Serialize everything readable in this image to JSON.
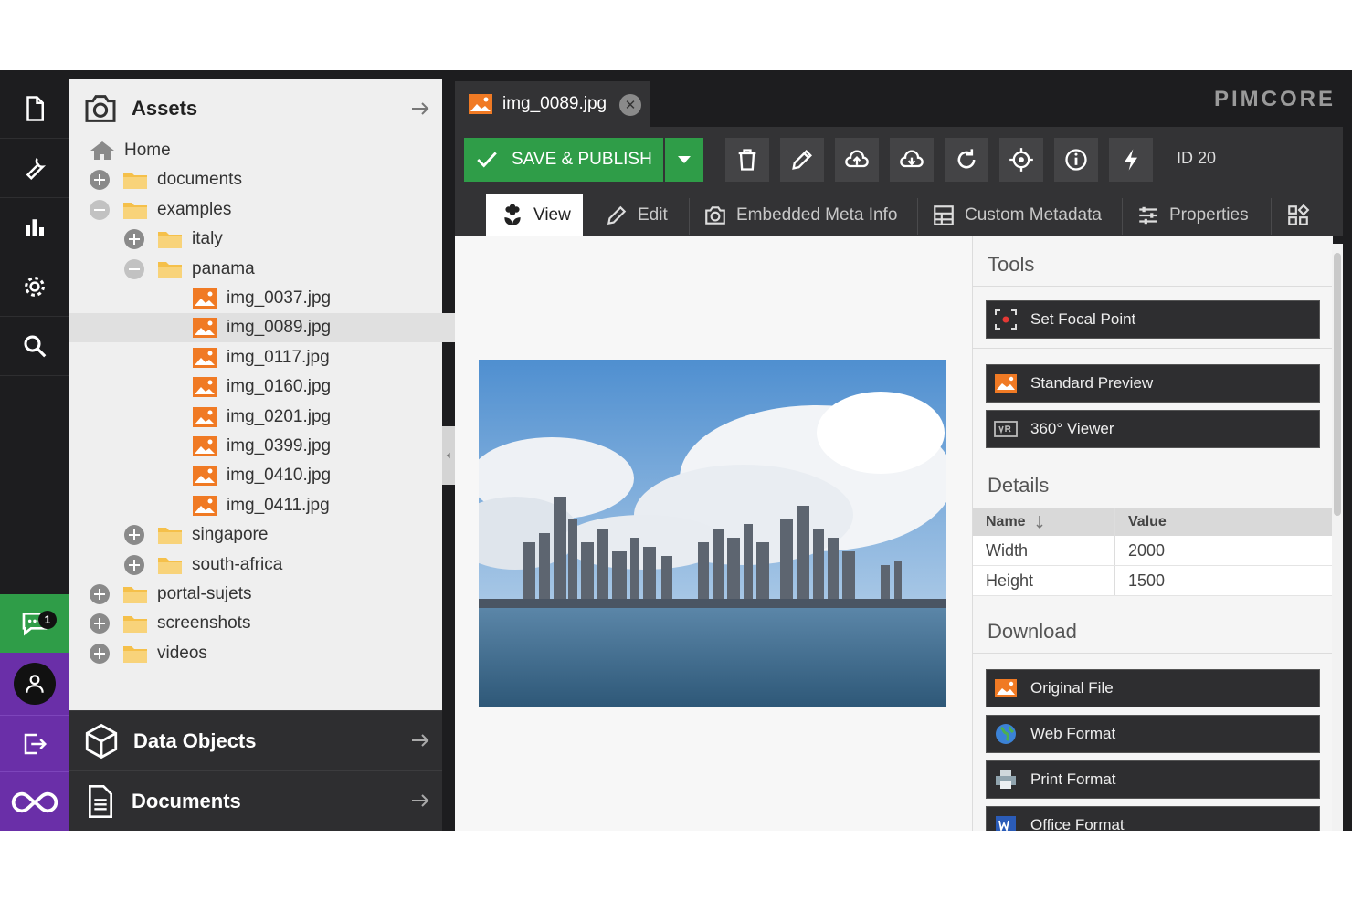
{
  "rail": {
    "items": [
      {
        "icon": "document-icon"
      },
      {
        "icon": "wrench-icon"
      },
      {
        "icon": "bar-chart-icon"
      },
      {
        "icon": "gear-icon"
      },
      {
        "icon": "search-icon"
      }
    ],
    "notification_count": "1"
  },
  "assets_panel": {
    "title": "Assets",
    "tree": [
      {
        "label": "Home",
        "type": "home",
        "level": 0
      },
      {
        "label": "documents",
        "type": "folder",
        "level": 0,
        "toggle": "plus"
      },
      {
        "label": "examples",
        "type": "folder",
        "level": 0,
        "toggle": "minus"
      },
      {
        "label": "italy",
        "type": "folder",
        "level": 1,
        "toggle": "plus"
      },
      {
        "label": "panama",
        "type": "folder",
        "level": 1,
        "toggle": "minus"
      },
      {
        "label": "img_0037.jpg",
        "type": "image",
        "level": 2
      },
      {
        "label": "img_0089.jpg",
        "type": "image",
        "level": 2,
        "selected": true
      },
      {
        "label": "img_0117.jpg",
        "type": "image",
        "level": 2
      },
      {
        "label": "img_0160.jpg",
        "type": "image",
        "level": 2
      },
      {
        "label": "img_0201.jpg",
        "type": "image",
        "level": 2
      },
      {
        "label": "img_0399.jpg",
        "type": "image",
        "level": 2
      },
      {
        "label": "img_0410.jpg",
        "type": "image",
        "level": 2
      },
      {
        "label": "img_0411.jpg",
        "type": "image",
        "level": 2
      },
      {
        "label": "singapore",
        "type": "folder",
        "level": 1,
        "toggle": "plus"
      },
      {
        "label": "south-africa",
        "type": "folder",
        "level": 1,
        "toggle": "plus"
      },
      {
        "label": "portal-sujets",
        "type": "folder",
        "level": 0,
        "toggle": "plus"
      },
      {
        "label": "screenshots",
        "type": "folder",
        "level": 0,
        "toggle": "plus"
      },
      {
        "label": "videos",
        "type": "folder",
        "level": 0,
        "toggle": "plus"
      }
    ]
  },
  "bottom_panels": [
    {
      "title": "Data Objects",
      "icon": "cube-icon"
    },
    {
      "title": "Documents",
      "icon": "document-lines-icon"
    }
  ],
  "editor": {
    "tab_title": "img_0089.jpg",
    "logo": "PIMCORE",
    "save_label": "SAVE & PUBLISH",
    "id_label": "ID 20",
    "toolbar_icons": [
      "trash-icon",
      "pencil-icon",
      "cloud-upload-icon",
      "cloud-download-icon",
      "reload-icon",
      "target-icon",
      "info-icon",
      "bolt-icon"
    ],
    "subtabs": [
      {
        "label": "View",
        "icon": "flower-icon",
        "active": true
      },
      {
        "label": "Edit",
        "icon": "pencil-icon"
      },
      {
        "label": "Embedded Meta Info",
        "icon": "camera-icon"
      },
      {
        "label": "Custom Metadata",
        "icon": "metadata-icon"
      },
      {
        "label": "Properties",
        "icon": "sliders-icon"
      },
      {
        "label": "",
        "icon": "grid-icon"
      }
    ]
  },
  "side": {
    "tools_title": "Tools",
    "set_focal_point": "Set Focal Point",
    "standard_preview": "Standard Preview",
    "viewer_360": "360° Viewer",
    "details_title": "Details",
    "details_header": {
      "name": "Name",
      "value": "Value"
    },
    "details_rows": [
      {
        "name": "Width",
        "value": "2000"
      },
      {
        "name": "Height",
        "value": "1500"
      }
    ],
    "download_title": "Download",
    "downloads": [
      {
        "label": "Original File",
        "icon": "image-icon"
      },
      {
        "label": "Web Format",
        "icon": "globe-icon"
      },
      {
        "label": "Print Format",
        "icon": "printer-icon"
      },
      {
        "label": "Office Format",
        "icon": "word-icon"
      }
    ]
  },
  "colors": {
    "accent_green": "#2f9d48",
    "accent_purple": "#6a2fa8",
    "image_orange": "#f07a24",
    "folder_yellow": "#f5c04a"
  }
}
